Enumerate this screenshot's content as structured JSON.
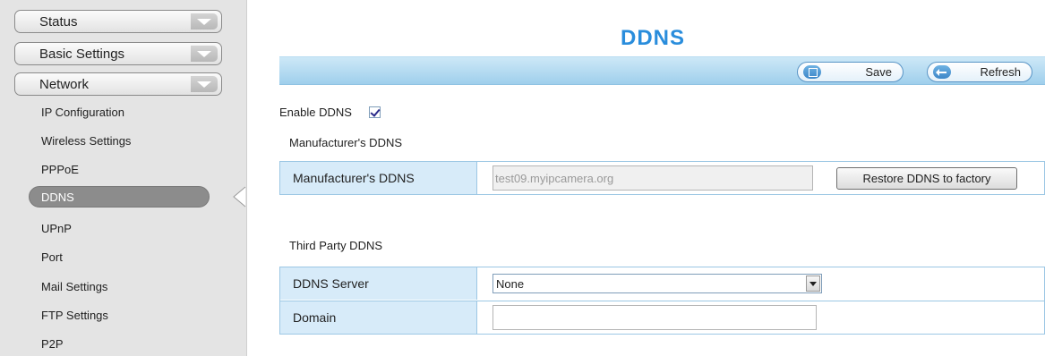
{
  "sidebar": {
    "menus": [
      {
        "label": "Status"
      },
      {
        "label": "Basic Settings"
      },
      {
        "label": "Network"
      }
    ],
    "items": [
      {
        "label": "IP Configuration"
      },
      {
        "label": "Wireless Settings"
      },
      {
        "label": "PPPoE"
      },
      {
        "label": "DDNS"
      },
      {
        "label": "UPnP"
      },
      {
        "label": "Port"
      },
      {
        "label": "Mail Settings"
      },
      {
        "label": "FTP Settings"
      },
      {
        "label": "P2P"
      }
    ],
    "active_item": "DDNS"
  },
  "page": {
    "title": "DDNS",
    "title_color": "#2a8ddc"
  },
  "toolbar": {
    "save_label": "Save",
    "save_icon": "save-icon",
    "refresh_label": "Refresh",
    "refresh_icon": "refresh-icon"
  },
  "enable_ddns": {
    "label": "Enable DDNS",
    "checked": true
  },
  "manufacturer": {
    "section_title": "Manufacturer's DDNS",
    "row_label": "Manufacturer's DDNS",
    "value": "test09.myipcamera.org",
    "restore_label": "Restore DDNS to factory"
  },
  "third_party": {
    "section_title": "Third Party DDNS",
    "server_label": "DDNS Server",
    "server_value": "None",
    "domain_label": "Domain",
    "domain_value": ""
  }
}
